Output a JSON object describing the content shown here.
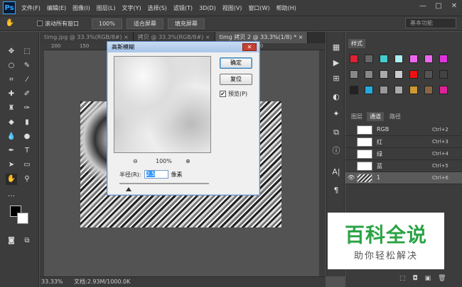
{
  "app": {
    "logo": "Ps"
  },
  "menu": [
    "文件(F)",
    "编辑(E)",
    "图像(I)",
    "图层(L)",
    "文字(Y)",
    "选择(S)",
    "滤镜(T)",
    "3D(D)",
    "视图(V)",
    "窗口(W)",
    "帮助(H)"
  ],
  "window_controls": {
    "min": "—",
    "max": "□",
    "close": "✕"
  },
  "options": {
    "scroll_all": "滚动所有窗口",
    "zoom_100": "100%",
    "fit_screen": "适合屏幕",
    "fill_screen": "填充屏幕",
    "workspace": "基本功能"
  },
  "tabs": [
    "timg.jpg @ 33.3%(RGB/8#) ×",
    "拷贝 @ 33.3%(RGB/8#) ×",
    "timg 拷贝 2 @ 33.3%(1/8) * ×"
  ],
  "ruler_ticks": [
    "200",
    "150",
    "100",
    "50",
    "0",
    "50",
    "100",
    "150"
  ],
  "status": {
    "zoom": "33.33%",
    "doc": "文档:2.93M/1000.0K"
  },
  "panels": {
    "swatches_tab": "样式",
    "layers_tab": "图层",
    "channels_tab": "通道",
    "paths_tab": "路径",
    "channels": [
      {
        "name": "RGB",
        "shortcut": "Ctrl+2"
      },
      {
        "name": "红",
        "shortcut": "Ctrl+3"
      },
      {
        "name": "绿",
        "shortcut": "Ctrl+4"
      },
      {
        "name": "蓝",
        "shortcut": "Ctrl+5"
      },
      {
        "name": "1",
        "shortcut": "Ctrl+6"
      }
    ]
  },
  "dialog": {
    "title": "高斯模糊",
    "ok": "确定",
    "reset": "复位",
    "preview_label": "预览(P)",
    "zoom_out": "⊖",
    "zoom_level": "100%",
    "zoom_in": "⊕",
    "radius_label": "半径(R):",
    "radius_value": "2.5",
    "radius_unit": "像素",
    "radius_slider_fraction": 0.1
  },
  "watermark": {
    "title": "百科全说",
    "subtitle": "助你轻松解决"
  },
  "colors": {
    "swatches": [
      "#d23",
      "#666",
      "#4cc",
      "#aee",
      "#e6e",
      "#e6e",
      "#d3d",
      "#888",
      "#888",
      "#aaa",
      "#ccc",
      "#e11",
      "#555",
      "#444",
      "#222",
      "#2ad",
      "#999",
      "#aaa",
      "#c93",
      "#864",
      "#d29"
    ]
  }
}
